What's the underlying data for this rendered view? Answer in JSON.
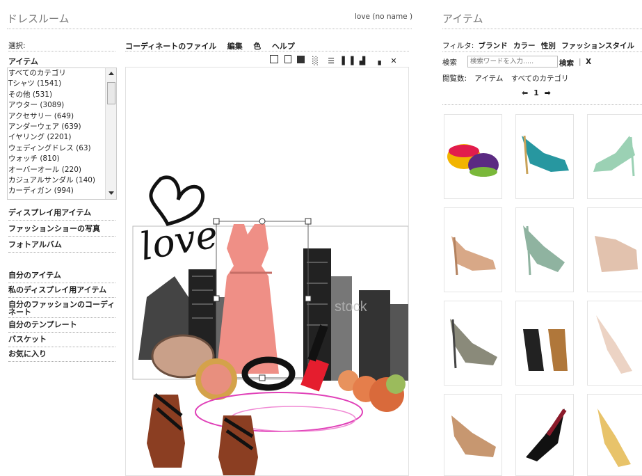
{
  "header": {
    "left_title": "ドレスルーム",
    "user": "love (no name )",
    "right_title": "アイテム"
  },
  "sidebar": {
    "select_label": "選択:",
    "items_label": "アイテム",
    "categories": [
      "すべてのカテゴリ",
      "Tシャツ (1541)",
      "その他 (531)",
      "アウター (3089)",
      "アクセサリー (649)",
      "アンダーウェア (639)",
      "イヤリング (2201)",
      "ウェディングドレス (63)",
      "ウォッチ (810)",
      "オーバーオール (220)",
      "カジュアルサンダル (140)",
      "カーディガン (994)"
    ],
    "links_top": [
      "ディスプレイ用アイテム",
      "ファッションショーの写真",
      "フォトアルバム"
    ],
    "links_bottom": [
      "自分のアイテム",
      "私のディスプレイ用アイテム",
      "自分のファッションのコーディネート",
      "自分のテンプレート",
      "バスケット",
      "お気に入り"
    ]
  },
  "editor": {
    "menu": [
      "コーディネートのファイル",
      "編集",
      "色",
      "ヘルプ"
    ],
    "canvas_text": "love",
    "watermark": "stock"
  },
  "right": {
    "filter_label": "フィルタ:",
    "filters": [
      "ブランド",
      "カラー",
      "性別",
      "ファッションスタイル"
    ],
    "search_label": "検索",
    "search_placeholder": "検索ワードを入力.....",
    "search_button": "検索",
    "clear": "X",
    "browse_label": "閲覧数:",
    "browse_item": "アイテム",
    "browse_cat": "すべてのカテゴリ",
    "page": "1"
  },
  "colors": {
    "dress": "#ef8f86",
    "accent": "#e51d2e"
  }
}
